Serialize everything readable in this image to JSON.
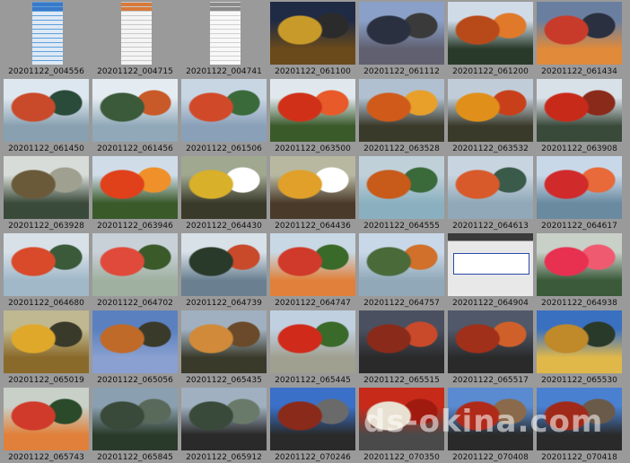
{
  "thumbnails": [
    {
      "caption": "20201122_004556",
      "palette": [
        "#dfe9f4",
        "#3a78c8",
        "#ffffff",
        "#5aa0e0"
      ],
      "kind": "doc"
    },
    {
      "caption": "20201122_004715",
      "palette": [
        "#f4f4f4",
        "#d97a3a",
        "#ffffff",
        "#c8c8c8"
      ],
      "kind": "doc"
    },
    {
      "caption": "20201122_004741",
      "palette": [
        "#f8f8f8",
        "#8a8a8a",
        "#ffffff",
        "#d0d0d0"
      ],
      "kind": "doc"
    },
    {
      "caption": "20201122_061100",
      "palette": [
        "#1f2a45",
        "#c89a2a",
        "#2b2b2b",
        "#6a4a1a"
      ],
      "kind": "photo"
    },
    {
      "caption": "20201122_061112",
      "palette": [
        "#8aa0c8",
        "#2a3040",
        "#3a3a3a",
        "#606070"
      ],
      "kind": "photo"
    },
    {
      "caption": "20201122_061200",
      "palette": [
        "#d0dbe8",
        "#b84a1a",
        "#e07a2a",
        "#2a3a2a"
      ],
      "kind": "photo"
    },
    {
      "caption": "20201122_061434",
      "palette": [
        "#6a7fa0",
        "#c83a2a",
        "#2a3040",
        "#e08a3a"
      ],
      "kind": "photo"
    },
    {
      "caption": "20201122_061450",
      "palette": [
        "#dde7ef",
        "#c84a2a",
        "#2a4a3a",
        "#88a0b0"
      ],
      "kind": "photo"
    },
    {
      "caption": "20201122_061456",
      "palette": [
        "#e4ecf2",
        "#3a5a3a",
        "#c85a2a",
        "#90a8b8"
      ],
      "kind": "photo"
    },
    {
      "caption": "20201122_061506",
      "palette": [
        "#c8d6e4",
        "#d04a2a",
        "#3a6a3a",
        "#8aa0b8"
      ],
      "kind": "photo"
    },
    {
      "caption": "20201122_063500",
      "palette": [
        "#e0e8ee",
        "#d03018",
        "#e85a2a",
        "#3a5a2a"
      ],
      "kind": "photo"
    },
    {
      "caption": "20201122_063528",
      "palette": [
        "#b0c0d0",
        "#d05a1a",
        "#e8a02a",
        "#3a3a2a"
      ],
      "kind": "photo"
    },
    {
      "caption": "20201122_063532",
      "palette": [
        "#c0ccd8",
        "#e0901a",
        "#c8401a",
        "#3a3a2a"
      ],
      "kind": "photo"
    },
    {
      "caption": "20201122_063908",
      "palette": [
        "#d8e0e8",
        "#c82a1a",
        "#8a2a1a",
        "#3a4a3a"
      ],
      "kind": "photo"
    },
    {
      "caption": "20201122_063928",
      "palette": [
        "#d8dcd8",
        "#6a5a3a",
        "#a0a090",
        "#3a4a3a"
      ],
      "kind": "photo"
    },
    {
      "caption": "20201122_063946",
      "palette": [
        "#d0dce8",
        "#e0401a",
        "#f0902a",
        "#3a5a2a"
      ],
      "kind": "photo"
    },
    {
      "caption": "20201122_064430",
      "palette": [
        "#a0a890",
        "#d8b02a",
        "#ffffff",
        "#3a3a2a"
      ],
      "kind": "photo"
    },
    {
      "caption": "20201122_064436",
      "palette": [
        "#b8b8a0",
        "#e0a02a",
        "#ffffff",
        "#4a3a2a"
      ],
      "kind": "photo"
    },
    {
      "caption": "20201122_064555",
      "palette": [
        "#c0d0d8",
        "#c85a1a",
        "#3a6a3a",
        "#8ab0c0"
      ],
      "kind": "photo"
    },
    {
      "caption": "20201122_064613",
      "palette": [
        "#c8d4e0",
        "#d85a2a",
        "#3a5a4a",
        "#90a8b8"
      ],
      "kind": "photo"
    },
    {
      "caption": "20201122_064617",
      "palette": [
        "#c8d8e8",
        "#d02a2a",
        "#e86a3a",
        "#6a8aa0"
      ],
      "kind": "photo"
    },
    {
      "caption": "20201122_064680",
      "palette": [
        "#d8e0e8",
        "#d84a2a",
        "#3a5a3a",
        "#a0b8c8"
      ],
      "kind": "photo"
    },
    {
      "caption": "20201122_064702",
      "palette": [
        "#c8d0d8",
        "#e04a3a",
        "#3a5a2a",
        "#a0b0a0"
      ],
      "kind": "photo"
    },
    {
      "caption": "20201122_064739",
      "palette": [
        "#d8e0e8",
        "#2a3a2a",
        "#c84a2a",
        "#6a8090"
      ],
      "kind": "photo"
    },
    {
      "caption": "20201122_064747",
      "palette": [
        "#c8d8e4",
        "#d03a2a",
        "#3a6a2a",
        "#e0803a"
      ],
      "kind": "photo"
    },
    {
      "caption": "20201122_064757",
      "palette": [
        "#c8d8e8",
        "#4a6a3a",
        "#d0702a",
        "#90a8b8"
      ],
      "kind": "photo"
    },
    {
      "caption": "20201122_064904",
      "palette": [
        "#e8e8e8",
        "#3a3a3a",
        "#ffffff",
        "#2a4aa8"
      ],
      "kind": "sign"
    },
    {
      "caption": "20201122_064938",
      "palette": [
        "#c8d0c8",
        "#e83050",
        "#f05a70",
        "#3a5a3a"
      ],
      "kind": "photo"
    },
    {
      "caption": "20201122_065019",
      "palette": [
        "#c0b890",
        "#e0a82a",
        "#3a3a2a",
        "#8a6a2a"
      ],
      "kind": "photo"
    },
    {
      "caption": "20201122_065056",
      "palette": [
        "#5a80c0",
        "#c06a2a",
        "#3a3a2a",
        "#8aa0d0"
      ],
      "kind": "photo"
    },
    {
      "caption": "20201122_065435",
      "palette": [
        "#a0b0c0",
        "#d08a3a",
        "#6a4a2a",
        "#3a3a2a"
      ],
      "kind": "photo"
    },
    {
      "caption": "20201122_065445",
      "palette": [
        "#c0d0e0",
        "#d02a1a",
        "#3a6a2a",
        "#a0a090"
      ],
      "kind": "photo"
    },
    {
      "caption": "20201122_065515",
      "palette": [
        "#4a5060",
        "#8a2a1a",
        "#c84a2a",
        "#2a2a2a"
      ],
      "kind": "photo"
    },
    {
      "caption": "20201122_065517",
      "palette": [
        "#50586a",
        "#a0301a",
        "#d0602a",
        "#2a2a2a"
      ],
      "kind": "photo"
    },
    {
      "caption": "20201122_065530",
      "palette": [
        "#3a70c0",
        "#c08a2a",
        "#2a3a2a",
        "#e0b84a"
      ],
      "kind": "photo"
    },
    {
      "caption": "20201122_065743",
      "palette": [
        "#c8d0c8",
        "#d03a2a",
        "#2a4a2a",
        "#e0803a"
      ],
      "kind": "photo"
    },
    {
      "caption": "20201122_065845",
      "palette": [
        "#8aa0b0",
        "#3a4a3a",
        "#5a6a5a",
        "#2a3a2a"
      ],
      "kind": "photo"
    },
    {
      "caption": "20201122_065912",
      "palette": [
        "#a0b0c0",
        "#3a4a3a",
        "#6a7a6a",
        "#2a2a2a"
      ],
      "kind": "photo"
    },
    {
      "caption": "20201122_070246",
      "palette": [
        "#3a70c8",
        "#8a2a1a",
        "#6a6a6a",
        "#2a2a2a"
      ],
      "kind": "photo"
    },
    {
      "caption": "20201122_070350",
      "palette": [
        "#c82a1a",
        "#e8e0d0",
        "#a01a10",
        "#4a4a4a"
      ],
      "kind": "photo"
    },
    {
      "caption": "20201122_070408",
      "palette": [
        "#5a8ad0",
        "#b02a1a",
        "#8a6a4a",
        "#2a2a2a"
      ],
      "kind": "photo"
    },
    {
      "caption": "20201122_070418",
      "palette": [
        "#4a80d0",
        "#a02a1a",
        "#6a5a4a",
        "#2a2a2a"
      ],
      "kind": "photo"
    }
  ],
  "sign_text": "",
  "watermark": "ds-okina.com"
}
